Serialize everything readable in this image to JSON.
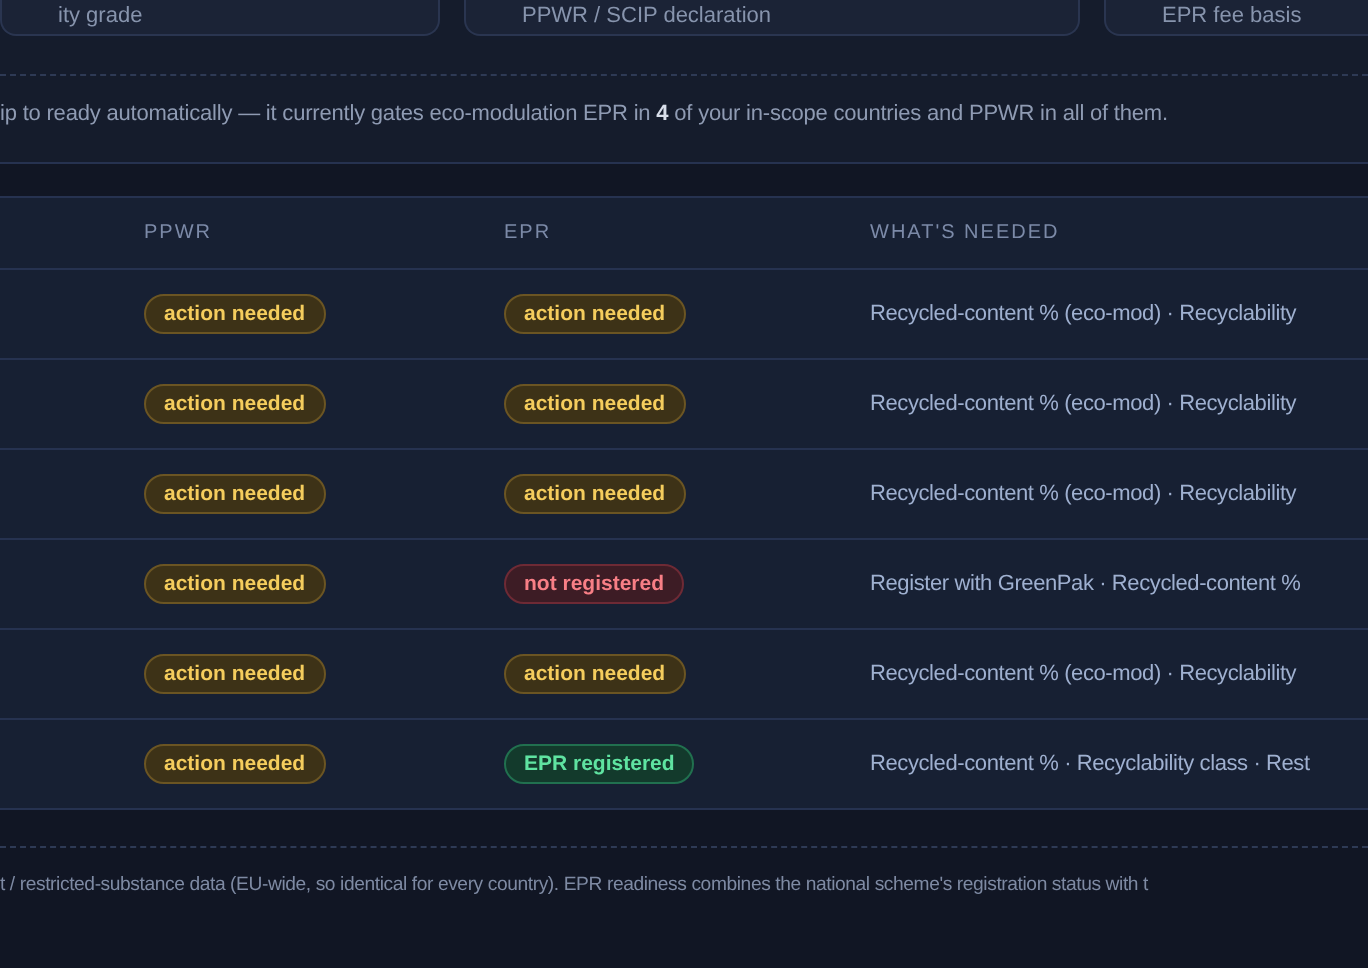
{
  "cards": [
    {
      "label": "ity grade"
    },
    {
      "label": "PPWR / SCIP declaration"
    },
    {
      "label": "EPR fee basis"
    }
  ],
  "note": "ip to ready automatically — it currently gates eco-modulation EPR in **4** of your in-scope countries and PPWR in all of them.",
  "table": {
    "columns": [
      "PPWR",
      "EPR",
      "WHAT'S NEEDED"
    ],
    "rows": [
      {
        "ppwr": {
          "label": "action needed",
          "kind": "action"
        },
        "epr": {
          "label": "action needed",
          "kind": "action"
        },
        "needed": "Recycled-content % (eco-mod) · Recyclability"
      },
      {
        "ppwr": {
          "label": "action needed",
          "kind": "action"
        },
        "epr": {
          "label": "action needed",
          "kind": "action"
        },
        "needed": "Recycled-content % (eco-mod) · Recyclability"
      },
      {
        "ppwr": {
          "label": "action needed",
          "kind": "action"
        },
        "epr": {
          "label": "action needed",
          "kind": "action"
        },
        "needed": "Recycled-content % (eco-mod) · Recyclability"
      },
      {
        "ppwr": {
          "label": "action needed",
          "kind": "action"
        },
        "epr": {
          "label": "not registered",
          "kind": "unregistered"
        },
        "needed": "Register with GreenPak · Recycled-content %"
      },
      {
        "ppwr": {
          "label": "action needed",
          "kind": "action"
        },
        "epr": {
          "label": "action needed",
          "kind": "action"
        },
        "needed": "Recycled-content % (eco-mod) · Recyclability"
      },
      {
        "ppwr": {
          "label": "action needed",
          "kind": "action"
        },
        "epr": {
          "label": "EPR registered",
          "kind": "registered"
        },
        "needed": "Recycled-content % · Recyclability class · Rest"
      }
    ]
  },
  "footnote": "t / restricted-substance data (EU-wide, so identical for every country). EPR readiness combines the national scheme's registration status with t"
}
